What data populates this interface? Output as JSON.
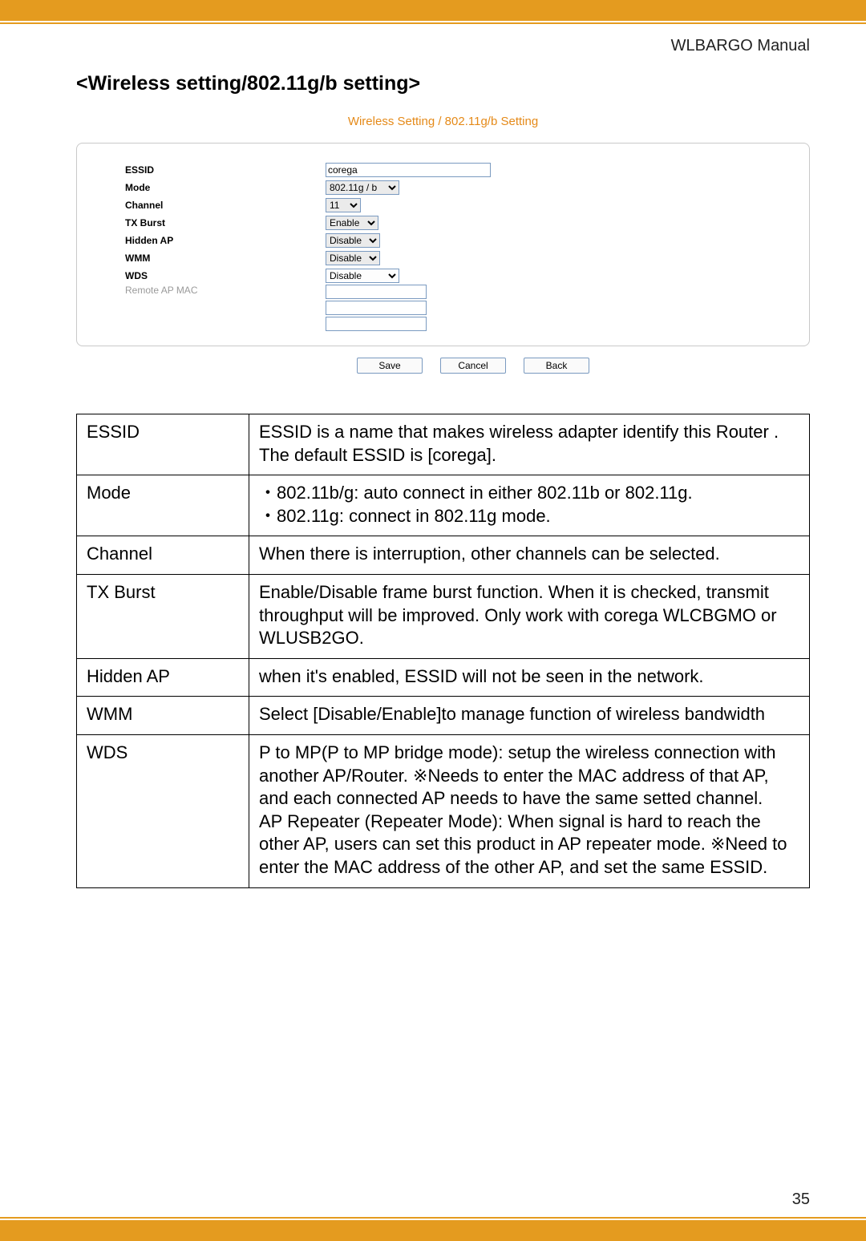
{
  "header": {
    "manual_title": "WLBARGO Manual"
  },
  "section": {
    "title": "<Wireless setting/802.11g/b setting>"
  },
  "screenshot": {
    "caption": "Wireless Setting / 802.11g/b Setting",
    "rows": {
      "essid": {
        "label": "ESSID",
        "value": "corega"
      },
      "mode": {
        "label": "Mode",
        "value": "802.11g / b"
      },
      "channel": {
        "label": "Channel",
        "value": "11"
      },
      "tx_burst": {
        "label": "TX Burst",
        "value": "Enable"
      },
      "hidden_ap": {
        "label": "Hidden AP",
        "value": "Disable"
      },
      "wmm": {
        "label": "WMM",
        "value": "Disable"
      },
      "wds": {
        "label": "WDS",
        "value": "Disable"
      },
      "remote_mac": {
        "label": "Remote AP MAC"
      }
    },
    "buttons": {
      "save": "Save",
      "cancel": "Cancel",
      "back": "Back"
    }
  },
  "table": {
    "rows": [
      {
        "k": "ESSID",
        "v": "ESSID is a name that makes wireless adapter identify this Router . The default ESSID is [corega]."
      },
      {
        "k": "Mode",
        "v": "・802.11b/g: auto connect in either 802.11b or 802.11g.\n・802.11g: connect in 802.11g mode."
      },
      {
        "k": "Channel",
        "v": "When there is interruption, other channels can be selected."
      },
      {
        "k": "TX Burst",
        "v": "Enable/Disable frame burst function. When it is checked, transmit throughput will be improved. Only work with corega WLCBGMO or WLUSB2GO."
      },
      {
        "k": "Hidden AP",
        "v": "when it's enabled, ESSID will not be seen in the network."
      },
      {
        "k": "WMM",
        "v": "Select [Disable/Enable]to manage function of wireless bandwidth"
      },
      {
        "k": "WDS",
        "v": "P to MP(P to MP bridge mode): setup the wireless connection with another AP/Router. ※Needs to enter the MAC address of that AP, and each connected AP needs to have the same setted channel.\nAP Repeater (Repeater Mode): When signal is hard to reach the other AP, users can set this product in AP repeater mode. ※Need to enter the MAC address of the other AP, and set the same ESSID."
      }
    ]
  },
  "page_number": "35"
}
